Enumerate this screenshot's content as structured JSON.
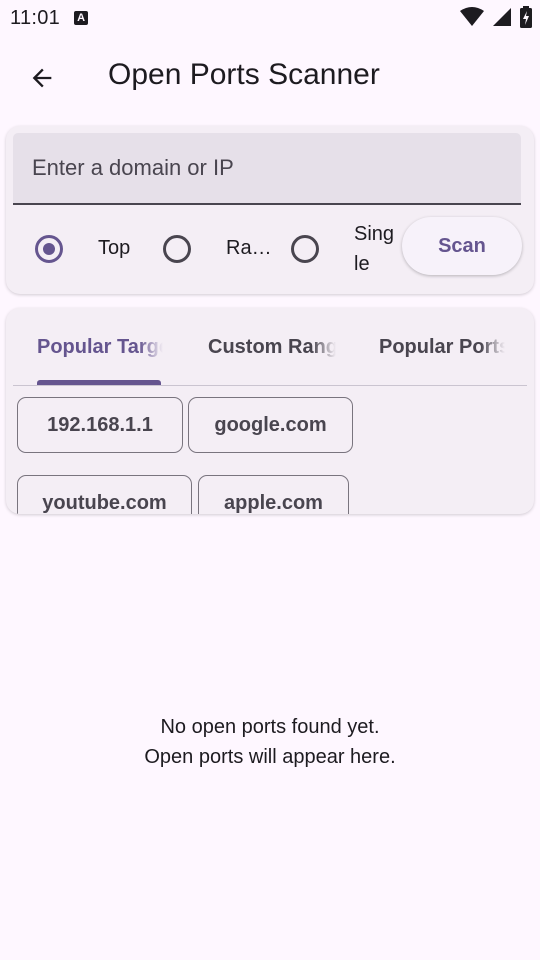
{
  "status_bar": {
    "time": "11:01",
    "notification_letter": "A"
  },
  "app_bar": {
    "title": "Open Ports Scanner"
  },
  "input": {
    "placeholder": "Enter a domain or IP",
    "value": ""
  },
  "scan_modes": [
    {
      "label": "Top",
      "selected": true
    },
    {
      "label": "Ra…",
      "selected": false
    },
    {
      "label_line1": "Sing",
      "label_line2": "le",
      "selected": false
    }
  ],
  "scan_button": "Scan",
  "tabs": [
    {
      "label": "Popular Targets",
      "active": true
    },
    {
      "label": "Custom Ranges",
      "active": false
    },
    {
      "label": "Popular Ports",
      "active": false
    }
  ],
  "targets": [
    "192.168.1.1",
    "google.com",
    "youtube.com",
    "apple.com"
  ],
  "empty_state": {
    "line1": "No open ports found yet.",
    "line2": "Open ports will appear here."
  },
  "colors": {
    "accent": "#65558F",
    "background": "#FEF7FF",
    "surface": "#F4EEF5"
  }
}
